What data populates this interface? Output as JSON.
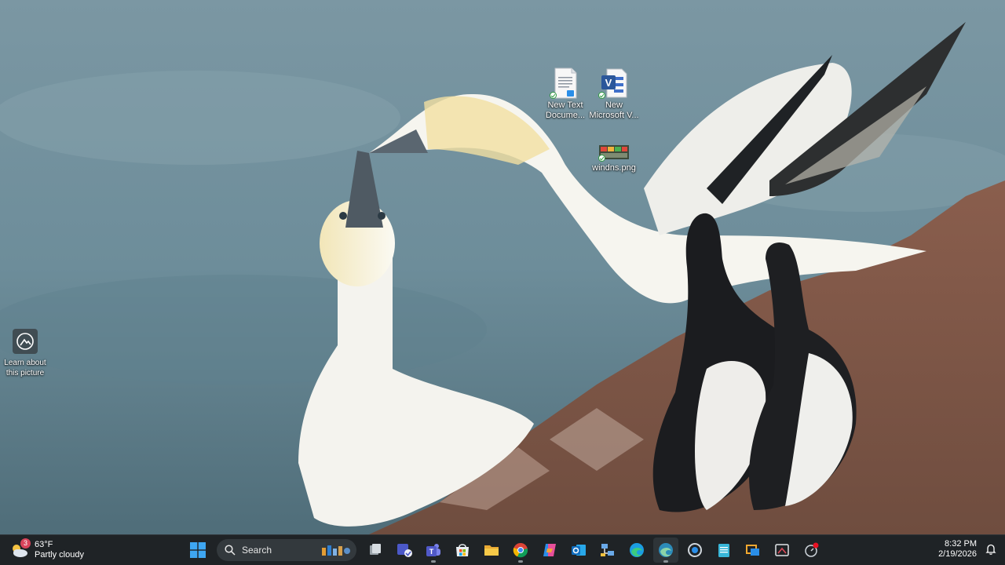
{
  "desktop": {
    "icons": [
      {
        "label": "New Text\nDocume...",
        "icon": "text-document-icon"
      },
      {
        "label": "New\nMicrosoft V...",
        "icon": "visio-file-icon"
      },
      {
        "label": "windns.png",
        "icon": "png-image-icon"
      }
    ],
    "spotlight": {
      "label": "Learn about\nthis picture",
      "icon": "learn-about-picture-icon"
    }
  },
  "taskbar": {
    "weather": {
      "temp": "63°F",
      "condition": "Partly cloudy",
      "badge": "3"
    },
    "search": {
      "placeholder": "Search"
    },
    "apps": [
      "start-button",
      "search-box",
      "task-view",
      "teams-meeting",
      "teams",
      "microsoft-store",
      "file-explorer",
      "chrome",
      "copilot",
      "outlook",
      "network-app",
      "edge",
      "edge-dev",
      "app-settings",
      "notepad",
      "remote-desktop",
      "snipping-tool",
      "record-app"
    ],
    "clock": {
      "time": "8:32 PM",
      "date": "2/19/2026"
    }
  },
  "colors": {
    "taskbar_bg": "#1f2326",
    "accent": "#2a8ee8"
  }
}
